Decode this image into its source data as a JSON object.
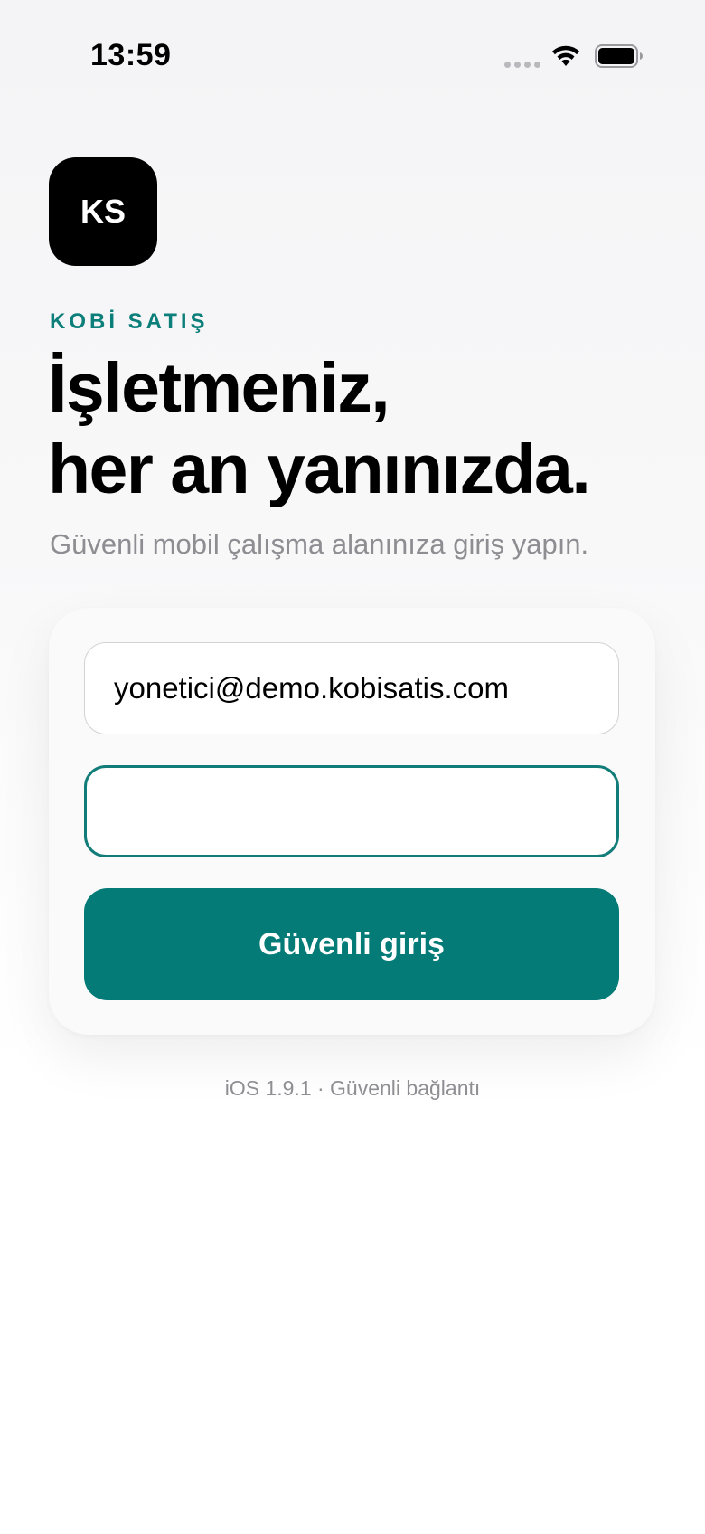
{
  "status_bar": {
    "time": "13:59"
  },
  "logo": {
    "text": "KS"
  },
  "brand": {
    "label": "KOBİ SATIŞ",
    "accent_color": "#047b77"
  },
  "hero": {
    "headline_line1": "İşletmeniz,",
    "headline_line2": "her an yanınızda.",
    "subtitle": "Güvenli mobil çalışma alanınıza giriş yapın."
  },
  "login_form": {
    "email_value": "yonetici@demo.kobisatis.com",
    "password_value": "",
    "submit_label": "Güvenli giriş"
  },
  "footer": {
    "note": "iOS 1.9.1 · Güvenli bağlantı"
  },
  "icons": {
    "wifi": "wifi-icon",
    "battery": "battery-icon",
    "cellular": "cellular-signal-icon"
  }
}
